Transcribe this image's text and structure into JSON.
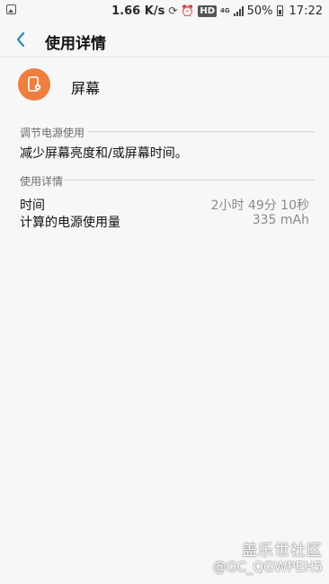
{
  "status_bar": {
    "speed": "1.66 K/s",
    "hd": "HD",
    "network": "4G",
    "battery": "50%",
    "time": "17:22",
    "icons": [
      "gallery-icon",
      "sync-icon",
      "alarm-icon",
      "signal-icon",
      "battery-icon"
    ]
  },
  "header": {
    "title": "使用详情"
  },
  "app": {
    "name": "屏幕",
    "icon": "screen-settings-icon",
    "icon_color": "#ef7f3e"
  },
  "sections": {
    "adjust": {
      "header": "调节电源使用",
      "text": "减少屏幕亮度和/或屏幕时间。"
    },
    "details": {
      "header": "使用详情",
      "rows": [
        {
          "label": "时间",
          "value": "2小时 49分 10秒"
        },
        {
          "label": "计算的电源使用量",
          "value": "335 mAh"
        }
      ]
    }
  },
  "watermark": {
    "line1": "盖乐世社区",
    "line2": "@GC_QGWPEH5"
  }
}
